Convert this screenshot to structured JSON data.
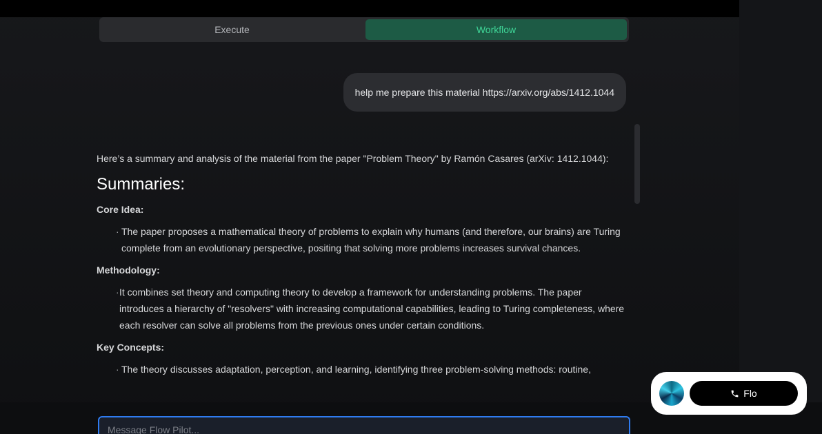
{
  "tabs": {
    "execute": "Execute",
    "workflow": "Workflow"
  },
  "user_message": "help me prepare this material https://arxiv.org/abs/1412.1044",
  "answer": {
    "intro": "Here’s a summary and analysis of the material from the paper \"Problem Theory\" by Ramón Casares (arXiv: 1412.1044):",
    "heading": "Summaries:",
    "sections": [
      {
        "title": "Core Idea:",
        "bullet": "The paper proposes a mathematical theory of problems to explain why humans (and therefore, our brains) are Turing complete from an evolutionary perspective, positing that solving more problems increases survival chances."
      },
      {
        "title": "Methodology:",
        "bullet": "It combines set theory and computing theory to develop a framework for understanding problems. The paper introduces a hierarchy of \"resolvers\" with increasing computational capabilities, leading to Turing completeness, where each resolver can solve all problems from the previous ones under certain conditions."
      },
      {
        "title": "Key Concepts:",
        "bullet": "The theory discusses adaptation, perception, and learning, identifying three problem-solving methods: routine,"
      }
    ]
  },
  "composer": {
    "placeholder": "Message Flow Pilot..."
  },
  "call_widget": {
    "label": "Flo"
  },
  "colors": {
    "accent_green": "#3fd597",
    "input_focus_border": "#2f7bf0"
  },
  "icons": {
    "phone": "phone-icon",
    "orb": "assistant-orb-avatar"
  }
}
